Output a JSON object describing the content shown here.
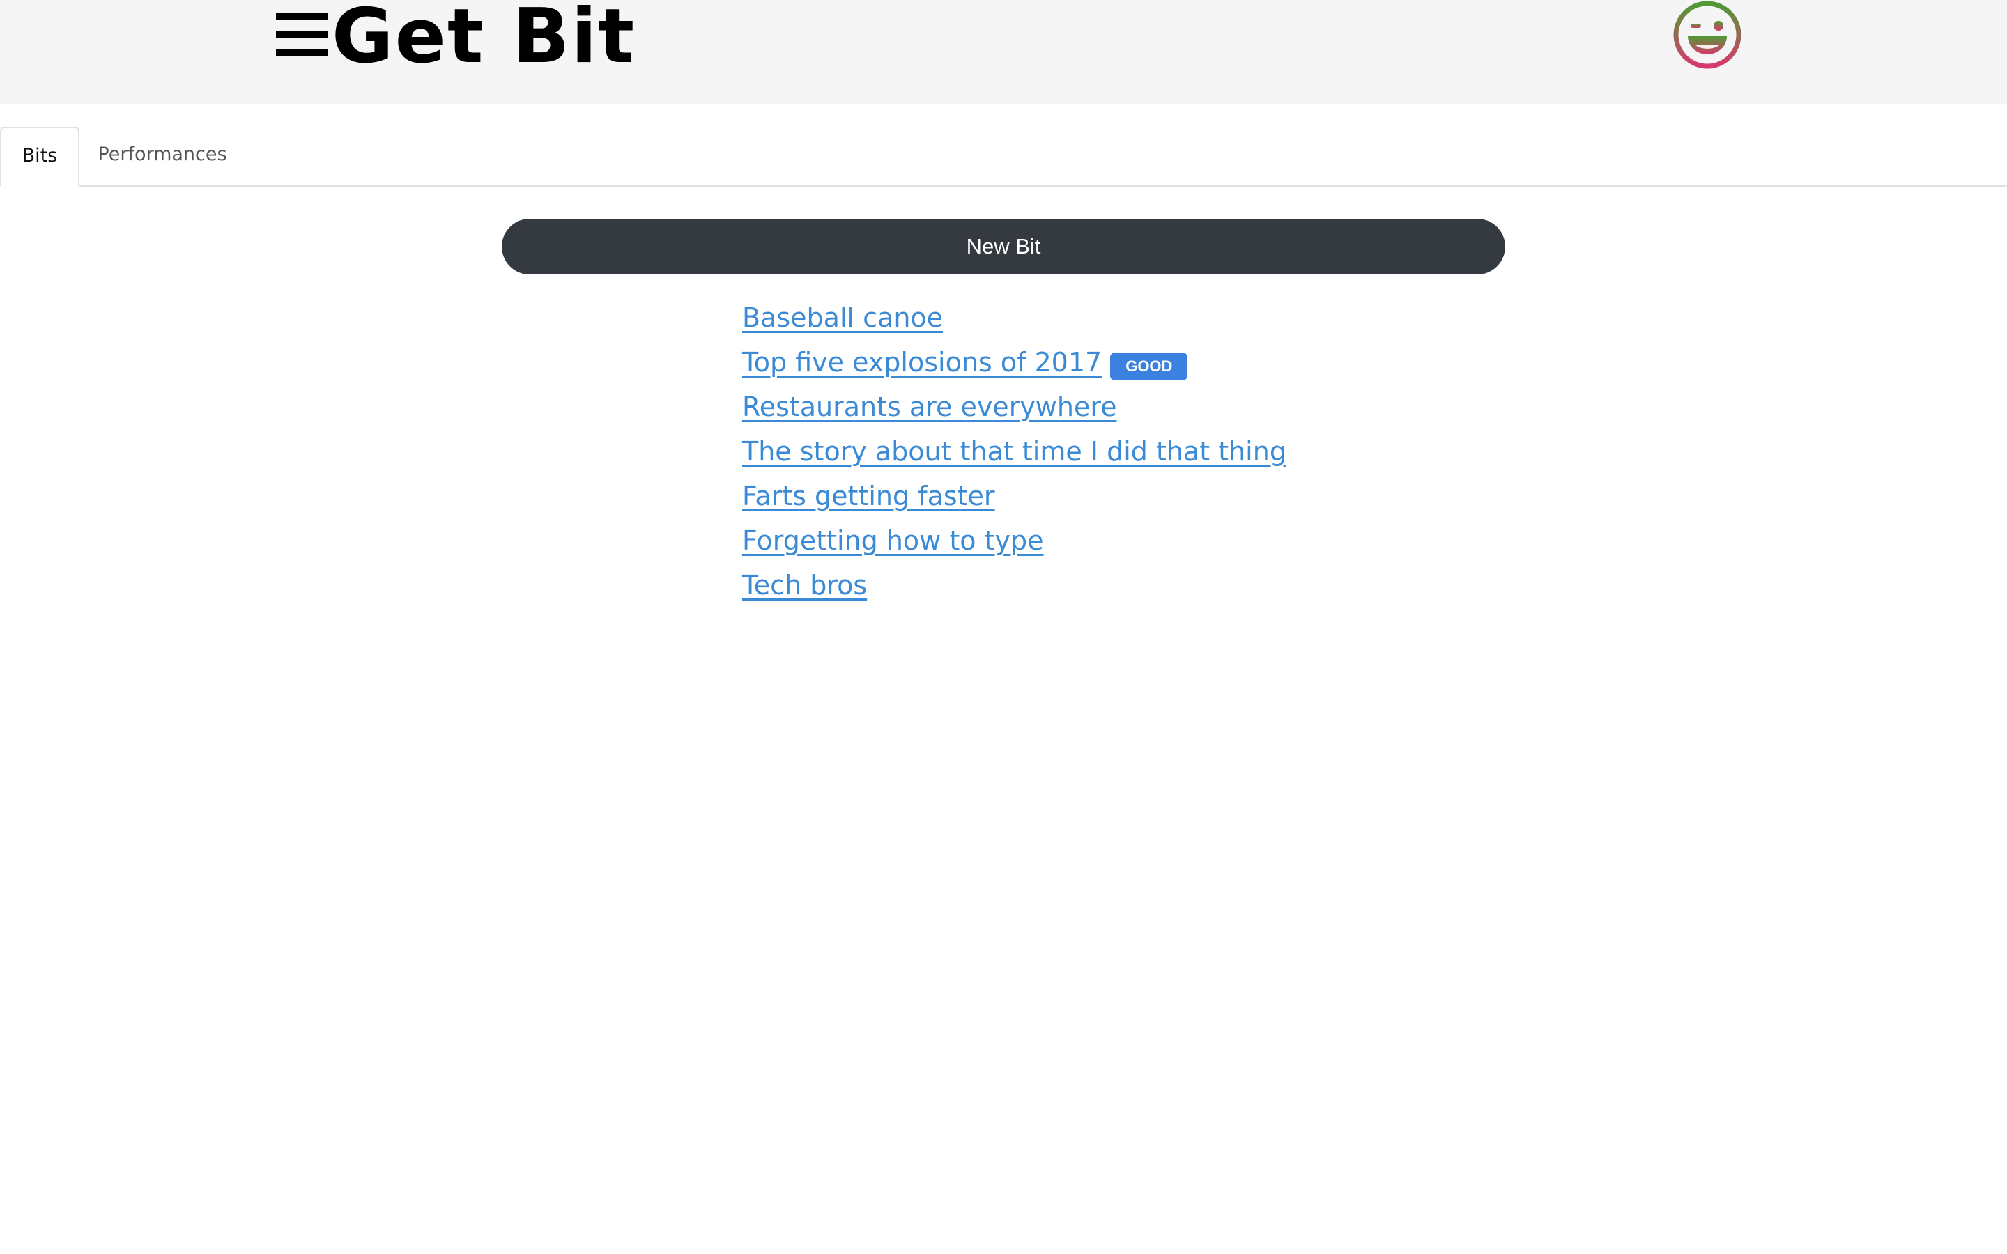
{
  "header": {
    "app_title": "Get Bit",
    "menu_icon": "hamburger-menu-icon",
    "avatar_icon": "laughing-face-icon"
  },
  "tabs": [
    {
      "label": "Bits",
      "active": true
    },
    {
      "label": "Performances",
      "active": false
    }
  ],
  "actions": {
    "new_bit_label": "New Bit"
  },
  "bits": [
    {
      "title": "Baseball canoe",
      "badge": ""
    },
    {
      "title": "Top five explosions of 2017",
      "badge": "GOOD"
    },
    {
      "title": "Restaurants are everywhere",
      "badge": ""
    },
    {
      "title": "The story about that time I did that thing",
      "badge": ""
    },
    {
      "title": "Farts getting faster",
      "badge": ""
    },
    {
      "title": "Forgetting how to type",
      "badge": ""
    },
    {
      "title": "Tech bros",
      "badge": ""
    }
  ],
  "colors": {
    "header_bg": "#f5f5f5",
    "button_bg": "#343a40",
    "link": "#3a8ad6",
    "badge_bg": "#3b82e0",
    "avatar_green": "#5a9a3c",
    "avatar_pink": "#d0396a"
  }
}
